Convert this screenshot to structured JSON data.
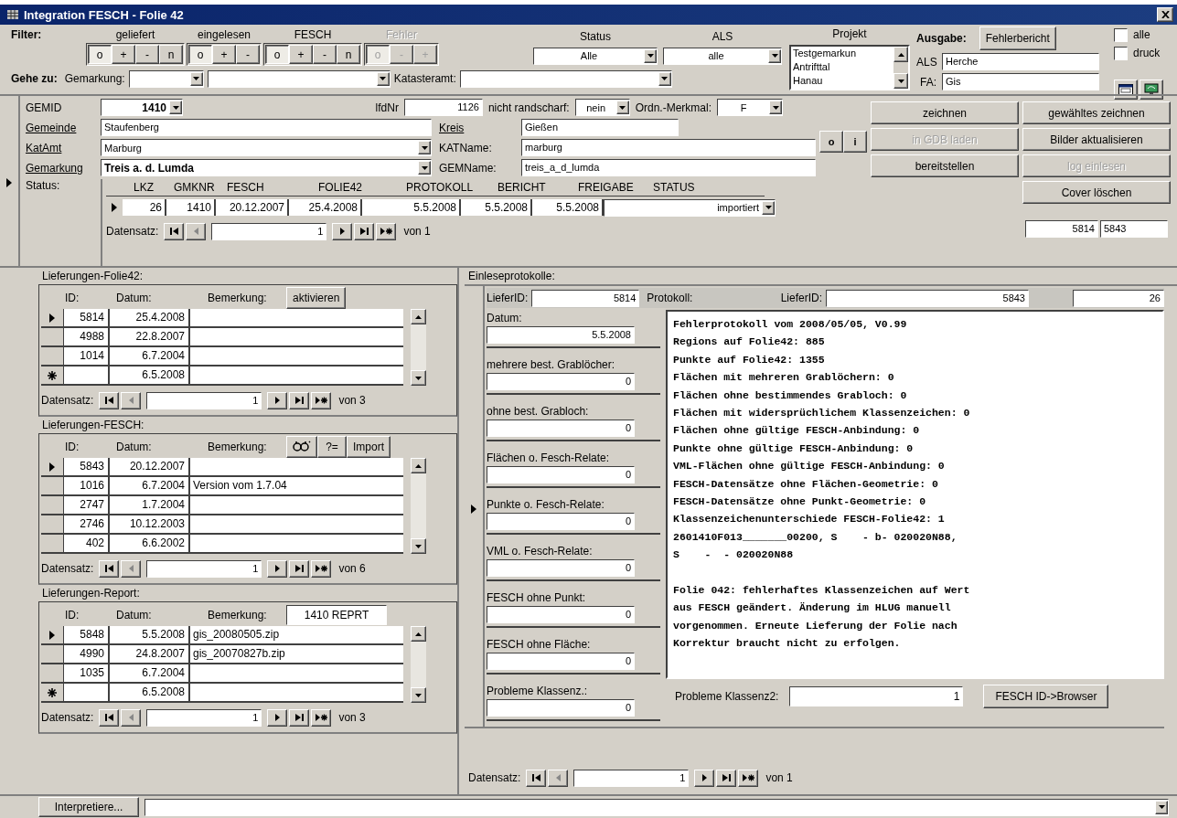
{
  "window": {
    "title": "Integration FESCH - Folie 42"
  },
  "filter": {
    "label": "Filter:",
    "groups": [
      {
        "label": "geliefert",
        "disabled": false,
        "buttons": [
          {
            "label": "o",
            "selected": true
          },
          {
            "label": "+",
            "selected": false
          },
          {
            "label": "-",
            "selected": false
          },
          {
            "label": "n",
            "selected": false
          }
        ]
      },
      {
        "label": "eingelesen",
        "disabled": false,
        "buttons": [
          {
            "label": "o",
            "selected": true
          },
          {
            "label": "+",
            "selected": false
          },
          {
            "label": "-",
            "selected": false
          }
        ]
      },
      {
        "label": "FESCH",
        "disabled": false,
        "buttons": [
          {
            "label": "o",
            "selected": true
          },
          {
            "label": "+",
            "selected": false
          },
          {
            "label": "-",
            "selected": false
          },
          {
            "label": "n",
            "selected": false
          }
        ]
      },
      {
        "label": "Fehler",
        "disabled": true,
        "buttons": [
          {
            "label": "o",
            "selected": true
          },
          {
            "label": "-",
            "selected": false
          },
          {
            "label": "+",
            "selected": false
          }
        ]
      }
    ]
  },
  "status_filter": {
    "label": "Status",
    "value": "Alle"
  },
  "als_filter": {
    "label": "ALS",
    "value": "alle"
  },
  "projekt": {
    "label": "Projekt",
    "items": [
      "Testgemarkun",
      "Antrifttal",
      "Hanau"
    ]
  },
  "ausgabe": {
    "label": "Ausgabe:",
    "button": "Fehlerbericht",
    "checkboxes": [
      {
        "label": "alle",
        "checked": false
      },
      {
        "label": "druck",
        "checked": false
      }
    ],
    "als": {
      "label": "ALS",
      "value": "Herche"
    },
    "fa": {
      "label": "FA:",
      "value": "Gis"
    }
  },
  "goto": {
    "label": "Gehe zu:",
    "gemarkung_label": "Gemarkung:",
    "katasteramt_label": "Katasteramt:"
  },
  "record": {
    "gemid": {
      "label": "GEMID",
      "value": "1410"
    },
    "lfdnr": {
      "label": "lfdNr",
      "value": "1126"
    },
    "randscharf": {
      "label": "nicht randscharf:",
      "value": "nein"
    },
    "ordn": {
      "label": "Ordn.-Merkmal:",
      "value": "F"
    },
    "gemeinde": {
      "label": "Gemeinde",
      "value": "Staufenberg",
      "link": true
    },
    "kreis": {
      "label": "Kreis",
      "value": "Gießen",
      "link": true
    },
    "katamt": {
      "label": "KatAmt",
      "value": "Marburg",
      "link": true
    },
    "katname": {
      "label": "KATName:",
      "value": "marburg",
      "link": false
    },
    "gemarkung": {
      "label": "Gemarkung",
      "value": "Treis a. d. Lumda",
      "link": true
    },
    "gemname": {
      "label": "GEMName:",
      "value": "treis_a_d_lumda",
      "link": false
    }
  },
  "status": {
    "label": "Status:",
    "columns": [
      "LKZ",
      "GMKNR",
      "FESCH",
      "FOLIE42",
      "PROTOKOLL",
      "BERICHT",
      "FREIGABE",
      "STATUS"
    ],
    "row": [
      "26",
      "1410",
      "20.12.2007",
      "25.4.2008",
      "5.5.2008",
      "5.5.2008",
      "5.5.2008",
      "importiert"
    ],
    "nav": {
      "label": "Datensatz:",
      "value": "1",
      "total": "von 1",
      "prev_disabled": true
    }
  },
  "small_buttons": [
    "o",
    "i"
  ],
  "actions": [
    {
      "label": "zeichnen",
      "disabled": false
    },
    {
      "label": "in GDB laden",
      "disabled": true
    },
    {
      "label": "bereitstellen",
      "disabled": false
    },
    {
      "label": "gewähltes zeichnen",
      "disabled": false
    },
    {
      "label": "Bilder aktualisieren",
      "disabled": false
    },
    {
      "label": "log einlesen",
      "disabled": true
    },
    {
      "label": "Cover löschen",
      "disabled": false
    }
  ],
  "ids": [
    "5814",
    "5843"
  ],
  "subforms": [
    {
      "title": "Lieferungen-Folie42:",
      "columns": [
        "ID:",
        "Datum:",
        "Bemerkung:"
      ],
      "header_controls": [
        {
          "kind": "button",
          "label": "aktivieren"
        }
      ],
      "rows": [
        {
          "id": "5814",
          "date": "25.4.2008",
          "current": true,
          "new_row": false
        },
        {
          "id": "4988",
          "date": "22.8.2007",
          "current": false,
          "new_row": false
        },
        {
          "id": "1014",
          "date": "6.7.2004",
          "current": false,
          "new_row": false
        },
        {
          "date": "6.5.2008",
          "current": false,
          "new_row": true
        }
      ],
      "nav": {
        "label": "Datensatz:",
        "value": "1",
        "total": "von 3",
        "prev_disabled": true
      }
    },
    {
      "title": "Lieferungen-FESCH:",
      "columns": [
        "ID:",
        "Datum:",
        "Bemerkung:"
      ],
      "header_controls": [
        {
          "kind": "icon_button"
        },
        {
          "kind": "button",
          "label": "?="
        },
        {
          "kind": "button",
          "label": "Import"
        }
      ],
      "rows": [
        {
          "id": "5843",
          "date": "20.12.2007",
          "current": true,
          "new_row": false
        },
        {
          "id": "1016",
          "date": "6.7.2004",
          "note": "Version vom 1.7.04",
          "current": false,
          "new_row": false
        },
        {
          "id": "2747",
          "date": "1.7.2004",
          "current": false,
          "new_row": false
        },
        {
          "id": "2746",
          "date": "10.12.2003",
          "current": false,
          "new_row": false
        },
        {
          "id": "402",
          "date": "6.6.2002",
          "current": false,
          "new_row": false
        }
      ],
      "nav": {
        "label": "Datensatz:",
        "value": "1",
        "total": "von 6",
        "prev_disabled": true
      }
    },
    {
      "title": "Lieferungen-Report:",
      "columns": [
        "ID:",
        "Datum:",
        "Bemerkung:"
      ],
      "header_controls": [
        {
          "kind": "field",
          "value": "1410 REPRT"
        }
      ],
      "rows": [
        {
          "id": "5848",
          "date": "5.5.2008",
          "note": "gis_20080505.zip",
          "current": true,
          "new_row": false
        },
        {
          "id": "4990",
          "date": "24.8.2007",
          "note": "gis_20070827b.zip",
          "current": false,
          "new_row": false
        },
        {
          "id": "1035",
          "date": "6.7.2004",
          "current": false,
          "new_row": false
        },
        {
          "date": "6.5.2008",
          "current": false,
          "new_row": true
        }
      ],
      "nav": {
        "label": "Datensatz:",
        "value": "1",
        "total": "von 3",
        "prev_disabled": true
      }
    }
  ],
  "einlese": {
    "title": "Einleseprotokolle:",
    "liefer_id": {
      "label": "LieferID:",
      "value": "5814"
    },
    "protocol_label": "Protokoll:",
    "liefer_id2": {
      "label": "LieferID:",
      "value": "5843"
    },
    "lkz": "26",
    "stats": [
      {
        "label": "Datum:",
        "value": "5.5.2008"
      },
      {
        "label": "mehrere best. Grablöcher:",
        "value": "0"
      },
      {
        "label": "ohne best. Grabloch:",
        "value": "0"
      },
      {
        "label": "Flächen o. Fesch-Relate:",
        "value": "0"
      },
      {
        "label": "Punkte o. Fesch-Relate:",
        "value": "0"
      },
      {
        "label": "VML o. Fesch-Relate:",
        "value": "0"
      },
      {
        "label": "FESCH ohne Punkt:",
        "value": "0"
      },
      {
        "label": "FESCH ohne Fläche:",
        "value": "0"
      },
      {
        "label": "Probleme Klassenz.:",
        "value": "0"
      }
    ],
    "protocol": [
      [
        "Fehlerprotokoll vom 2008/05/05, V0.99",
        "Regions auf Folie42: 885",
        "Punkte auf Folie42: 1355",
        "Flächen mit mehreren Grablöchern: 0",
        "Flächen ohne bestimmendes Grabloch: 0",
        "Flächen mit widersprüchlichem Klassenzeichen: 0",
        "Flächen ohne gültige FESCH-Anbindung: 0",
        "Punkte ohne gültige FESCH-Anbindung: 0",
        "VML-Flächen ohne gültige FESCH-Anbindung: 0",
        "FESCH-Datensätze ohne Flächen-Geometrie: 0",
        "FESCH-Datensätze ohne Punkt-Geometrie: 0",
        "Klassenzeichenunterschiede FESCH-Folie42: 1",
        "2601410F013_______00200, S    - b- 020020N88,",
        "S    -  - 020020N88"
      ],
      [
        "Folie 042: fehlerhaftes Klassenzeichen auf Wert",
        "aus FESCH geändert. Änderung im HLUG manuell",
        "vorgenommen. Erneute Lieferung der Folie nach",
        "Korrektur braucht nicht zu erfolgen."
      ]
    ],
    "problems2": {
      "label": "Probleme Klassenz2:",
      "value": "1"
    },
    "browser_button": "FESCH ID->Browser",
    "nav": {
      "label": "Datensatz:",
      "value": "1",
      "total": "von 1",
      "prev_disabled": true
    }
  },
  "bottom": {
    "button": "Interpretiere..."
  }
}
